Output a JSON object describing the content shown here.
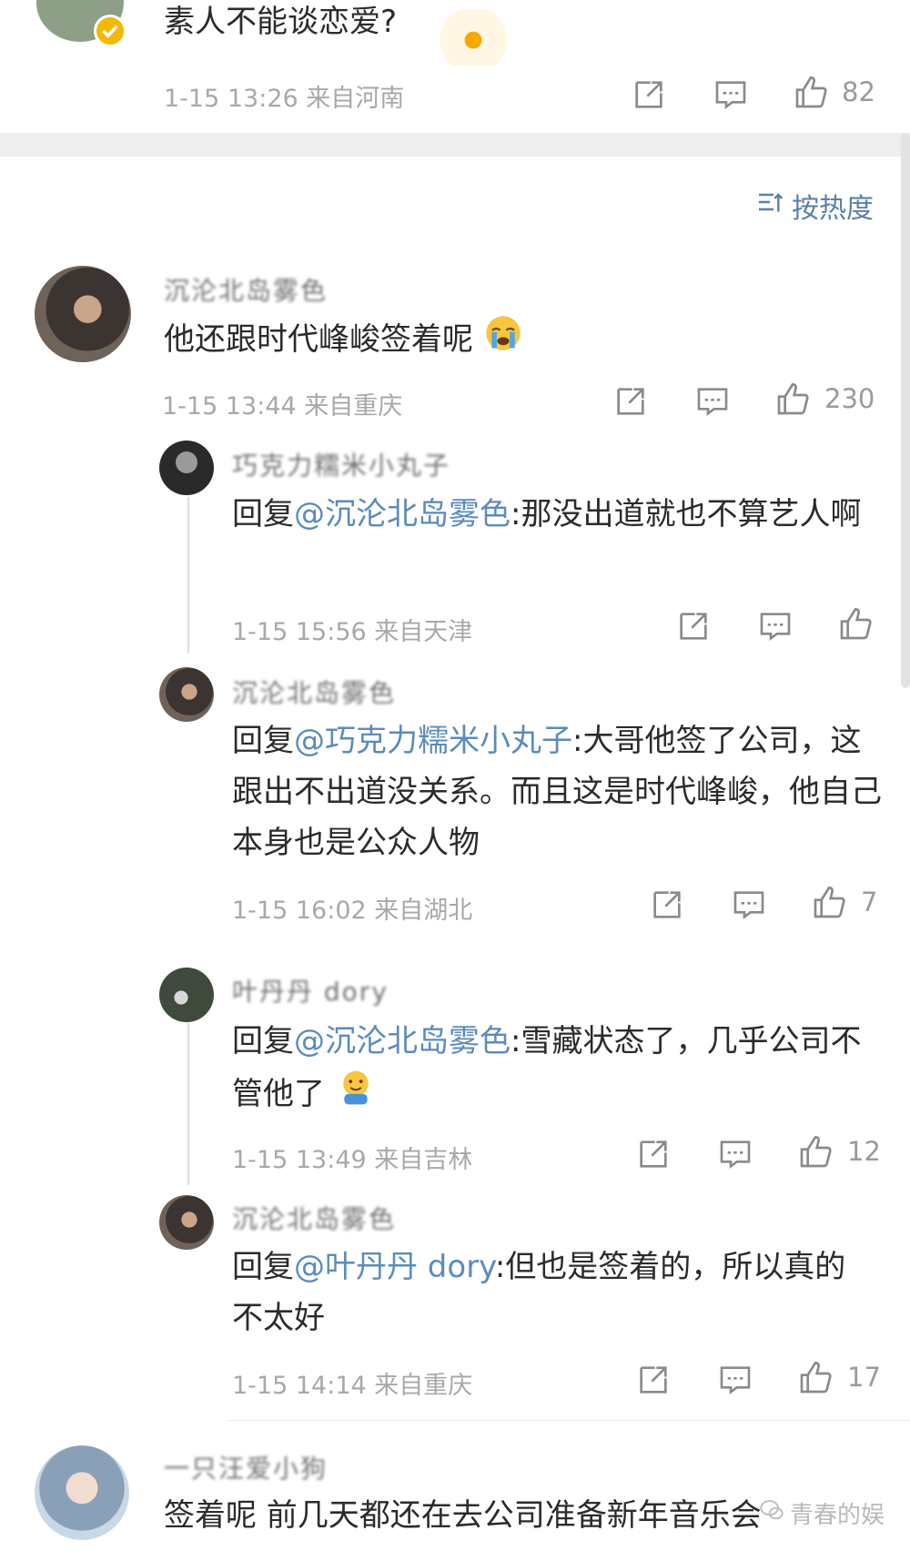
{
  "top_post": {
    "text": "素人不能谈恋爱?",
    "time_loc": "1-15 13:26  来自河南",
    "likes": "82"
  },
  "sort": {
    "label": "按热度",
    "icon": "sort-icon"
  },
  "comments": [
    {
      "username": "沉沦北岛雾色",
      "text": "他还跟时代峰峻签着呢",
      "emoji": "crying-face",
      "time_loc": "1-15 13:44  来自重庆",
      "likes": "230"
    }
  ],
  "replies": [
    {
      "username": "巧克力糯米小丸子",
      "reply_prefix": "回复",
      "mention": "@沉沦北岛雾色",
      "text": ":那没出道就也不算艺人啊",
      "time_loc": "1-15 15:56  来自天津",
      "likes": ""
    },
    {
      "username": "沉沦北岛雾色",
      "reply_prefix": "回复",
      "mention": "@巧克力糯米小丸子",
      "text": ":大哥他签了公司，这跟出不出道没关系。而且这是时代峰峻，他自己本身也是公众人物",
      "time_loc": "1-15 16:02  来自湖北",
      "likes": "7"
    },
    {
      "username": "叶丹丹 dory",
      "reply_prefix": "回复",
      "mention": "@沉沦北岛雾色",
      "text": ":雪藏状态了，几乎公司不管他了",
      "emoji": "hug-face",
      "time_loc": "1-15 13:49  来自吉林",
      "likes": "12"
    },
    {
      "username": "沉沦北岛雾色",
      "reply_prefix": "回复",
      "mention": "@叶丹丹 dory",
      "text": ":但也是签着的，所以真的不太好",
      "time_loc": "1-15 14:14  来自重庆",
      "likes": "17"
    }
  ],
  "last_comment": {
    "username": "一只汪爱小狗",
    "text": "签着呢 前几天都还在去公司准备新年音乐会"
  },
  "watermark": "青春的娱",
  "colors": {
    "link": "#5b8bbd",
    "meta": "#a8a8a8",
    "text": "#2b2b2b"
  }
}
